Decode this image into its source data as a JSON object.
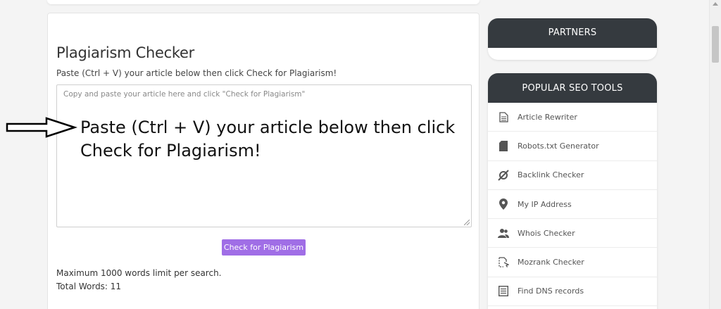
{
  "main": {
    "title": "Plagiarism Checker",
    "instructions": "Paste (Ctrl + V) your article below then click Check for Plagiarism!",
    "textarea_placeholder": "Copy and paste your article here and click \"Check for Plagiarism\"",
    "textarea_value_line1": "Paste (Ctrl + V) your article below then click",
    "textarea_value_line2": "Check for Plagiarism!",
    "check_button_label": "Check for Plagiarism",
    "limit_text": "Maximum 1000 words limit per search.",
    "word_count_text": "Total Words: 11"
  },
  "sidebar": {
    "partners_title": "PARTNERS",
    "tools_title": "POPULAR SEO TOOLS",
    "tools": [
      {
        "label": "Article Rewriter",
        "icon": "document-icon"
      },
      {
        "label": "Robots.txt Generator",
        "icon": "file-icon"
      },
      {
        "label": "Backlink Checker",
        "icon": "link-icon"
      },
      {
        "label": "My IP Address",
        "icon": "map-pin-icon"
      },
      {
        "label": "Whois Checker",
        "icon": "users-icon"
      },
      {
        "label": "Mozrank Checker",
        "icon": "mozrank-icon"
      },
      {
        "label": "Find DNS records",
        "icon": "list-icon"
      }
    ]
  },
  "colors": {
    "button": "#a06ee6",
    "panel_header": "#353a3f"
  }
}
